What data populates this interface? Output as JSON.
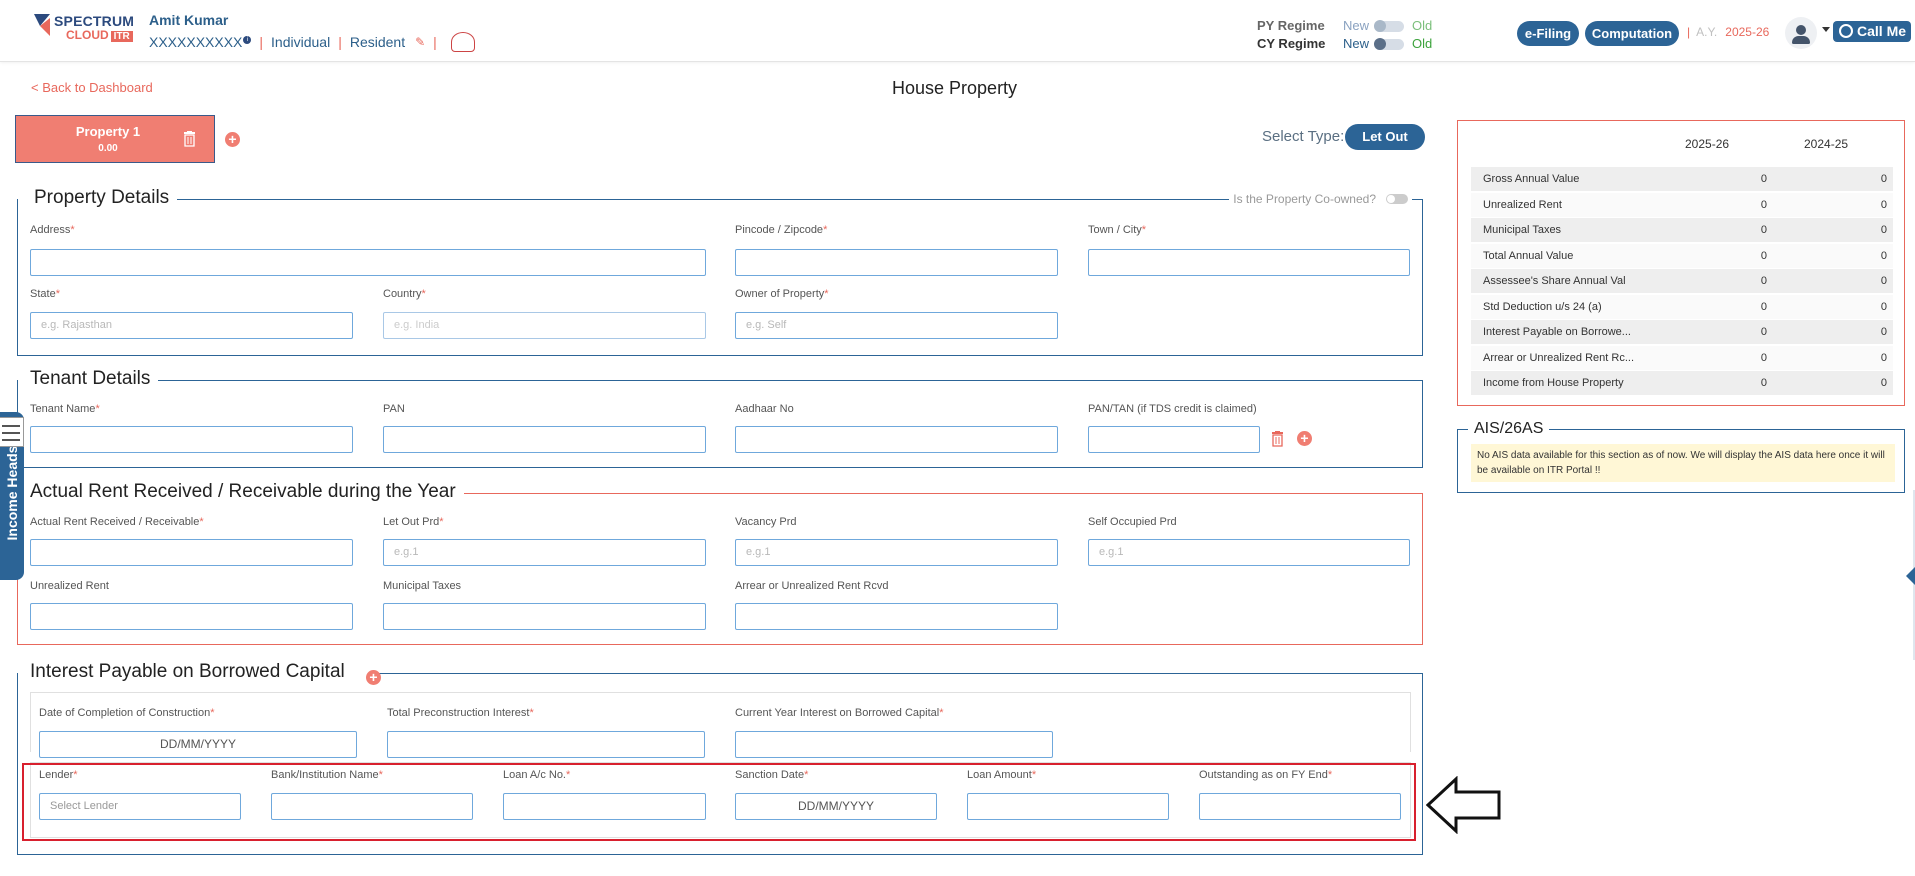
{
  "header": {
    "logo_main": "SPECTRUM",
    "logo_sub": "CLOUD",
    "logo_badge": "ITR",
    "user_name": "Amit Kumar",
    "pan": "XXXXXXXXXX",
    "info_glyph": "i",
    "status": "Individual",
    "residency": "Resident",
    "py_regime_label": "PY Regime",
    "cy_regime_label": "CY Regime",
    "new_label": "New",
    "old_label": "Old",
    "efiling_label": "e-Filing",
    "computation_label": "Computation",
    "ay_label": "A.Y.",
    "ay_value": "2025-26",
    "callme_label": "Call Me"
  },
  "page": {
    "back_link": "< Back to Dashboard",
    "title": "House Property",
    "property_tab_name": "Property 1",
    "property_tab_amount": "0.00",
    "select_type_label": "Select Type:",
    "select_type_value": "Let Out"
  },
  "property_details": {
    "legend": "Property Details",
    "coowned_label": "Is the Property Co-owned?",
    "address_label": "Address",
    "pincode_label": "Pincode / Zipcode",
    "town_label": "Town / City",
    "state_label": "State",
    "state_placeholder": "e.g. Rajasthan",
    "country_label": "Country",
    "country_placeholder": "e.g. India",
    "owner_label": "Owner of Property",
    "owner_placeholder": "e.g. Self"
  },
  "tenant_details": {
    "legend": "Tenant Details",
    "name_label": "Tenant Name",
    "pan_label": "PAN",
    "aadhaar_label": "Aadhaar No",
    "pantan_label": "PAN/TAN (if TDS credit is claimed)"
  },
  "rent": {
    "legend": "Actual Rent Received / Receivable during the Year",
    "actual_label": "Actual Rent Received / Receivable",
    "letout_label": "Let Out Prd",
    "letout_placeholder": "e.g.1",
    "vacancy_label": "Vacancy Prd",
    "vacancy_placeholder": "e.g.1",
    "selfocc_label": "Self Occupied Prd",
    "selfocc_placeholder": "e.g.1",
    "unrealized_label": "Unrealized Rent",
    "municipal_label": "Municipal Taxes",
    "arrear_label": "Arrear or Unrealized Rent Rcvd"
  },
  "interest": {
    "legend": "Interest Payable on Borrowed Capital",
    "doc_label": "Date of Completion of Construction",
    "doc_value": "DD/MM/YYYY",
    "preconst_label": "Total Preconstruction Interest",
    "cy_interest_label": "Current Year Interest on Borrowed Capital",
    "lender_label": "Lender",
    "lender_placeholder": "Select Lender",
    "bank_label": "Bank/Institution Name",
    "loan_no_label": "Loan A/c No.",
    "sanction_label": "Sanction Date",
    "sanction_value": "DD/MM/YYYY",
    "loan_amount_label": "Loan Amount",
    "outstanding_label": "Outstanding as on FY End"
  },
  "summary": {
    "col1": "2025-26",
    "col2": "2024-25",
    "rows": [
      {
        "label": "Gross Annual Value",
        "v1": "0",
        "v2": "0"
      },
      {
        "label": "Unrealized Rent",
        "v1": "0",
        "v2": "0"
      },
      {
        "label": "Municipal Taxes",
        "v1": "0",
        "v2": "0"
      },
      {
        "label": "Total Annual Value",
        "v1": "0",
        "v2": "0"
      },
      {
        "label": "Assessee's Share Annual Val",
        "v1": "0",
        "v2": "0"
      },
      {
        "label": "Std Deduction u/s 24 (a)",
        "v1": "0",
        "v2": "0"
      },
      {
        "label": "Interest Payable on Borrowe...",
        "v1": "0",
        "v2": "0"
      },
      {
        "label": "Arrear or Unrealized Rent Rc...",
        "v1": "0",
        "v2": "0"
      },
      {
        "label": "Income from House Property",
        "v1": "0",
        "v2": "0"
      }
    ]
  },
  "ais": {
    "legend": "AIS/26AS",
    "message": "No AIS data available for this section as of now. We will display the AIS data here once it will be available on ITR Portal !!"
  },
  "side_tab": {
    "label": "Income Heads"
  },
  "common": {
    "required_mark": "*",
    "add_glyph": "+",
    "separator": "|"
  },
  "colors": {
    "primary": "#2c6496",
    "accent": "#e8685c",
    "highlight_border": "#d8202e"
  }
}
